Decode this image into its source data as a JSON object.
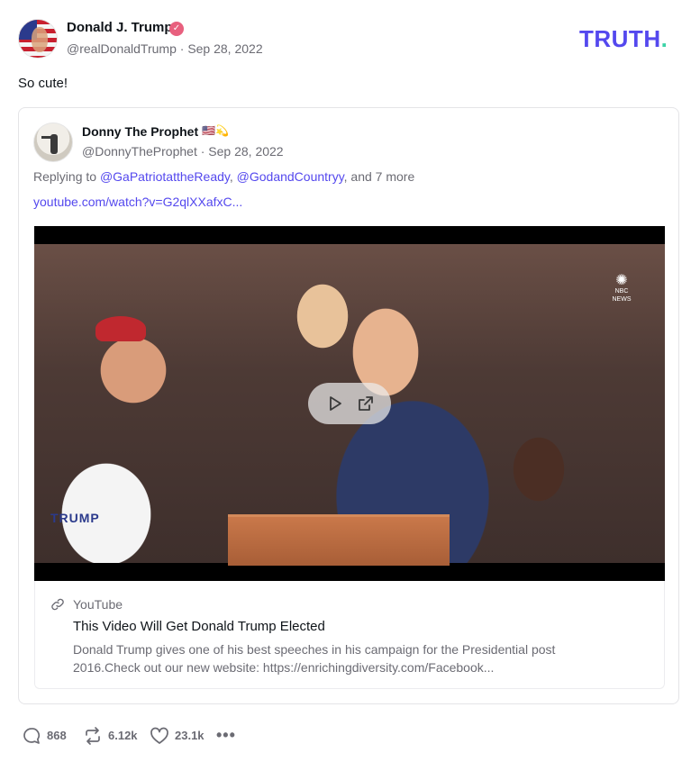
{
  "post": {
    "author_name": "Donald J. Trump",
    "author_handle": "@realDonaldTrump",
    "separator": "·",
    "date": "Sep 28, 2022",
    "text": "So cute!",
    "verified_icon": "verified-badge-icon"
  },
  "brand": {
    "logo_text": "TRUTH",
    "logo_dot": ".",
    "accent": "#5448ee",
    "dot_color": "#3bd3a6"
  },
  "quote": {
    "author_name": "Donny The Prophet",
    "author_emoji": "🇺🇸💫",
    "author_handle": "@DonnyTheProphet",
    "separator": "·",
    "date": "Sep 28, 2022",
    "reply_prefix": "Replying to",
    "mention_1": "@GaPatriotattheReady",
    "comma": ",",
    "mention_2": "@GodandCountryy",
    "reply_suffix": ", and 7 more",
    "link": "youtube.com/watch?v=G2qlXXafxC...",
    "video": {
      "watermark": "NBC NEWS",
      "shirt_text": "TRUMP"
    },
    "card": {
      "provider": "YouTube",
      "title": "This Video Will Get Donald Trump Elected",
      "description": "Donald Trump gives one of his best speeches in his campaign for the Presidential post 2016.Check out our new website: https://enrichingdiversity.com/Facebook..."
    }
  },
  "actions": {
    "replies": "868",
    "retruths": "6.12k",
    "likes": "23.1k",
    "more": "•••"
  }
}
